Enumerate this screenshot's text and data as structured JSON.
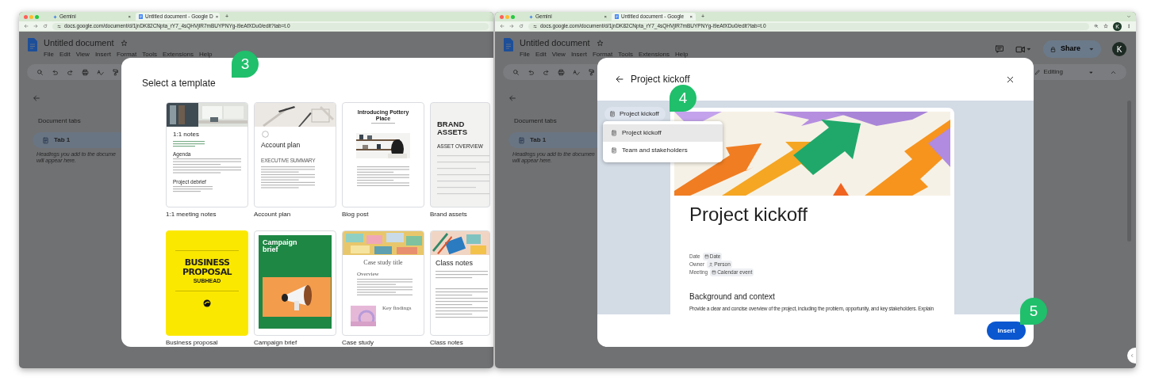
{
  "windows": [
    {
      "kind": "picker",
      "browser": {
        "tabs": [
          {
            "title": "Gemini",
            "selected": false,
            "close": "×"
          },
          {
            "title": "Untitled document - Google D",
            "selected": true,
            "close": "×"
          }
        ],
        "new_tab": "+",
        "url": "docs.google.com/document/d/1jnDK82CNpta_rY7_4sQHVjlR7mBUYPNYg-i9eAfXDu0/edit?tab=t.0"
      },
      "docs": {
        "title": "Untitled document",
        "menu": [
          "File",
          "Edit",
          "View",
          "Insert",
          "Format",
          "Tools",
          "Extensions",
          "Help"
        ]
      },
      "sidebar": {
        "heading": "Document tabs",
        "tabs": [
          {
            "label": "Tab 1",
            "selected": true
          }
        ],
        "hint_lines": [
          "Headings you add to the docume",
          "will appear here."
        ]
      },
      "dialog": {
        "kind": "template_picker",
        "title": "Select a template",
        "templates": [
          {
            "name": "1:1 meeting notes",
            "kind": "notes",
            "texts": [
              "1:1 notes",
              "Agenda",
              "Project debrief"
            ]
          },
          {
            "name": "Account plan",
            "kind": "account",
            "texts": [
              "Account plan",
              "EXECUTIVE SUMMARY"
            ]
          },
          {
            "name": "Blog post",
            "kind": "blog",
            "texts": [
              "Introducing Pottery Place"
            ]
          },
          {
            "name": "Brand assets",
            "kind": "brand",
            "texts": [
              "BRAND ASSETS",
              "ASSET OVERVIEW"
            ]
          },
          {
            "name": "Business proposal",
            "kind": "proposal",
            "texts": [
              "BUSINESS PROPOSAL",
              "SUBHEAD"
            ]
          },
          {
            "name": "Campaign brief",
            "kind": "campaign",
            "texts": [
              "Campaign brief"
            ]
          },
          {
            "name": "Case study",
            "kind": "case",
            "texts": [
              "Case study title",
              "Overview",
              "Key findings"
            ]
          },
          {
            "name": "Class notes",
            "kind": "class",
            "texts": [
              "Class notes"
            ]
          }
        ]
      },
      "callouts": [
        {
          "text": "3"
        }
      ]
    },
    {
      "kind": "preview",
      "browser": {
        "tabs": [
          {
            "title": "Gemini",
            "selected": false,
            "close": "×"
          },
          {
            "title": "Untitled document - Google",
            "selected": true,
            "close": "×"
          }
        ],
        "new_tab": "+",
        "url": "docs.google.com/document/d/1jnDK82CNpta_rY7_4sQHVjlR7mBUYPNYg-i9eAfXDu0/edit?tab=t.0",
        "profile": "K"
      },
      "docs": {
        "title": "Untitled document",
        "menu": [
          "File",
          "Edit",
          "View",
          "Insert",
          "Format",
          "Tools",
          "Extensions",
          "Help"
        ],
        "share": "Share",
        "avatar": "K",
        "mode": "Editing"
      },
      "sidebar": {
        "heading": "Document tabs",
        "tabs": [
          {
            "label": "Tab 1",
            "selected": true
          }
        ],
        "hint_lines": [
          "Headings you add to the documen",
          "will appear here."
        ]
      },
      "dialog": {
        "kind": "template_preview",
        "title": "Project kickoff",
        "tab_chip": "Project kickoff",
        "tab_menu": [
          {
            "label": "Project kickoff",
            "selected": true
          },
          {
            "label": "Team and stakeholders",
            "selected": false
          }
        ],
        "document": {
          "title": "Project kickoff",
          "fields": [
            {
              "label": "Date",
              "chip": "Date"
            },
            {
              "label": "Owner",
              "chip": "Person"
            },
            {
              "label": "Meeting",
              "chip": "Calendar event"
            }
          ],
          "heading": "Background and context",
          "paragraph": "Provide a clear and concise overview of the project, including the problem, opportunity, and key stakeholders. Explain"
        },
        "button": "Insert"
      },
      "callouts": [
        {
          "text": "4"
        },
        {
          "text": "5"
        }
      ]
    }
  ]
}
